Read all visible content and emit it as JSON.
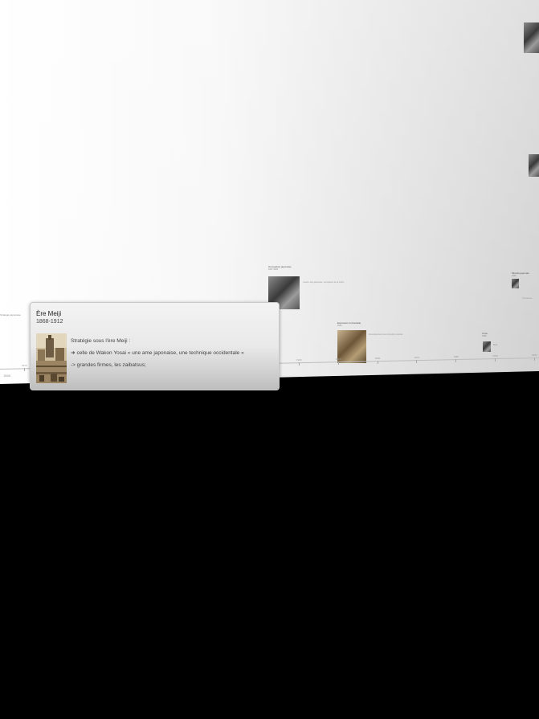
{
  "timeline": {
    "left_stub": "Stratégie japonaise",
    "left_year": "1868",
    "ticks": [
      "1870",
      "1880",
      "1890",
      "1900",
      "1910",
      "1920",
      "1930",
      "1940",
      "1950",
      "1960",
      "1970",
      "1980",
      "1990",
      "2000"
    ]
  },
  "events": [
    {
      "title": "Ère Meiji",
      "dates": "1868-1912",
      "lines": [
        "Stratégie sous l'ère Meiji :",
        "celle de Wakon Yosai « une ame japonaise, une technique occidentale »",
        "-> grandes firmes, les zaibatsus;"
      ],
      "bullet": "➔",
      "image_icon": "historic-city-photo"
    }
  ],
  "background_events": [
    {
      "title": "Occupation japonaise",
      "dates": "1937-1945",
      "line": "Guerre sino-japonaise, occupation de la Chine"
    },
    {
      "title": "Expansion industrielle",
      "dates": "1914",
      "line": "Développement des industries lourdes"
    },
    {
      "title": "Miracle japonais",
      "dates": "1950",
      "line": "Croissance"
    },
    {
      "title": "Crise",
      "dates": "1990",
      "line": "Bulle"
    }
  ]
}
